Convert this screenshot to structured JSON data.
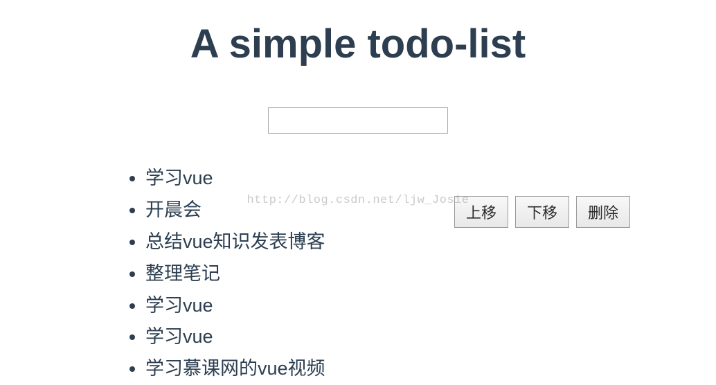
{
  "header": {
    "title": "A simple todo-list"
  },
  "input": {
    "value": ""
  },
  "todos": [
    {
      "text": "学习vue",
      "completed": false,
      "active": false
    },
    {
      "text": "开晨会",
      "completed": true,
      "active": true
    },
    {
      "text": "总结vue知识发表博客",
      "completed": false,
      "active": false
    },
    {
      "text": "整理笔记",
      "completed": false,
      "active": false
    },
    {
      "text": "学习vue",
      "completed": false,
      "active": false
    },
    {
      "text": "学习vue",
      "completed": false,
      "active": false
    },
    {
      "text": "学习慕课网的vue视频",
      "completed": false,
      "active": false
    }
  ],
  "buttons": {
    "move_up": "上移",
    "move_down": "下移",
    "delete": "删除"
  },
  "watermark": "http://blog.csdn.net/ljw_Josie"
}
